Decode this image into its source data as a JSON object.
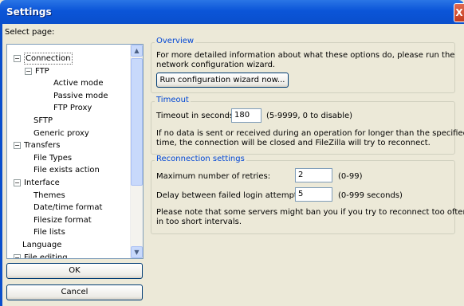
{
  "window": {
    "title": "Settings",
    "close_glyph": "X"
  },
  "sidebar": {
    "label": "Select page:",
    "tree": [
      {
        "label": "Connection",
        "level": 0,
        "toggle": "−",
        "selected": true
      },
      {
        "label": "FTP",
        "level": 1,
        "toggle": "−"
      },
      {
        "label": "Active mode",
        "level": 2
      },
      {
        "label": "Passive mode",
        "level": 2
      },
      {
        "label": "FTP Proxy",
        "level": 2
      },
      {
        "label": "SFTP",
        "level": 1
      },
      {
        "label": "Generic proxy",
        "level": 1
      },
      {
        "label": "Transfers",
        "level": 0,
        "toggle": "−"
      },
      {
        "label": "File Types",
        "level": 1
      },
      {
        "label": "File exists action",
        "level": 1
      },
      {
        "label": "Interface",
        "level": 0,
        "toggle": "−"
      },
      {
        "label": "Themes",
        "level": 1
      },
      {
        "label": "Date/time format",
        "level": 1
      },
      {
        "label": "Filesize format",
        "level": 1
      },
      {
        "label": "File lists",
        "level": 1
      },
      {
        "label": "Language",
        "level": 0
      },
      {
        "label": "File editing",
        "level": 0,
        "toggle": "−"
      }
    ],
    "ok_label": "OK",
    "cancel_label": "Cancel"
  },
  "overview": {
    "title": "Overview",
    "text_line1": "For more detailed information about what these options do, please run the",
    "text_line2": "network configuration wizard.",
    "wizard_button": "Run configuration wizard now..."
  },
  "timeout": {
    "title": "Timeout",
    "label": "Timeout in seconds:",
    "value": "180",
    "hint": "(5-9999, 0 to disable)",
    "desc_line1": "If no data is sent or received during an operation for longer than the specified",
    "desc_line2": "time, the connection will be closed and FileZilla will try to reconnect."
  },
  "reconnection": {
    "title": "Reconnection settings",
    "retries_label": "Maximum number of retries:",
    "retries_value": "2",
    "retries_hint": "(0-99)",
    "delay_label": "Delay between failed login attempts:",
    "delay_value": "5",
    "delay_hint": "(0-999 seconds)",
    "note_line1": "Please note that some servers might ban you if you try to reconnect too often or",
    "note_line2": "in too short intervals."
  }
}
